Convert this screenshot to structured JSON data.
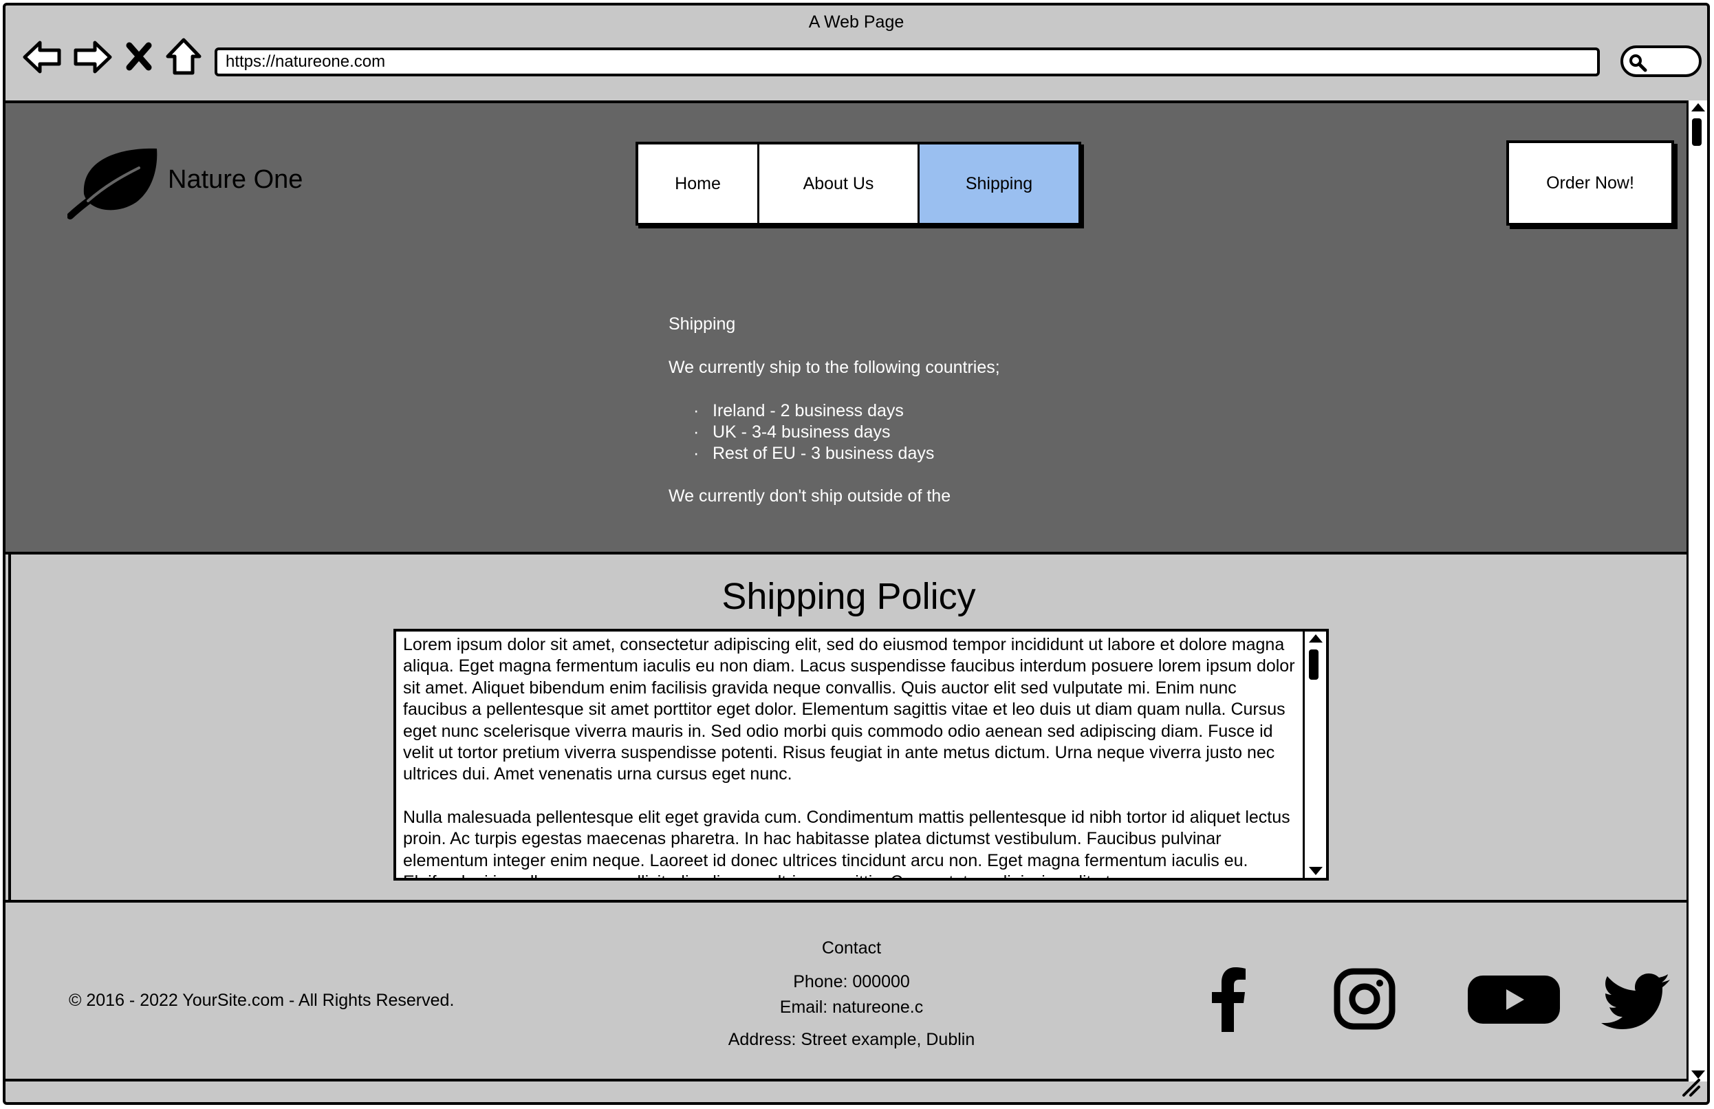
{
  "browser": {
    "title": "A Web Page",
    "url": "https://natureone.com"
  },
  "header": {
    "logo_text": "Nature One",
    "nav": [
      {
        "label": "Home"
      },
      {
        "label": "About Us"
      },
      {
        "label": "Shipping",
        "active": true
      }
    ],
    "order_label": "Order Now!",
    "active_tab_color": "#9abff0",
    "background_color": "#656565"
  },
  "shipping": {
    "heading": "Shipping",
    "intro": "We currently ship to the following countries;",
    "countries": [
      "Ireland - 2 business days",
      "UK - 3-4 business days",
      "Rest of EU - 3 business days"
    ],
    "note": "We currently don't ship outside of the"
  },
  "policy": {
    "title": "Shipping Policy",
    "paragraphs": [
      "Lorem ipsum dolor sit amet, consectetur adipiscing elit, sed do eiusmod tempor incididunt ut labore et dolore magna aliqua. Eget magna fermentum iaculis eu non diam. Lacus suspendisse faucibus interdum posuere lorem ipsum dolor sit amet. Aliquet bibendum enim facilisis gravida neque convallis. Quis auctor elit sed vulputate mi. Enim nunc faucibus a pellentesque sit amet porttitor eget dolor. Elementum sagittis vitae et leo duis ut diam quam nulla. Cursus eget nunc scelerisque viverra mauris in. Sed odio morbi quis commodo odio aenean sed adipiscing diam. Fusce id velit ut tortor pretium viverra suspendisse potenti. Risus feugiat in ante metus dictum. Urna neque viverra justo nec ultrices dui. Amet venenatis urna cursus eget nunc.",
      "Nulla malesuada pellentesque elit eget gravida cum. Condimentum mattis pellentesque id nibh tortor id aliquet lectus proin. Ac turpis egestas maecenas pharetra. In hac habitasse platea dictumst vestibulum. Faucibus pulvinar elementum integer enim neque. Laoreet id donec ultrices tincidunt arcu non. Eget magna fermentum iaculis eu. Eleifend mi in nulla posuere sollicitudin aliquam ultrices sagittis. Consectetur adipiscing elit ut."
    ]
  },
  "footer": {
    "copyright": "© 2016 - 2022 YourSite.com - All Rights Reserved.",
    "contact_heading": "Contact",
    "phone": "Phone: 000000",
    "email": "Email: natureone.c",
    "address": "Address: Street example, Dublin",
    "social_icons": [
      "facebook-icon",
      "instagram-icon",
      "youtube-icon",
      "twitter-icon"
    ]
  }
}
